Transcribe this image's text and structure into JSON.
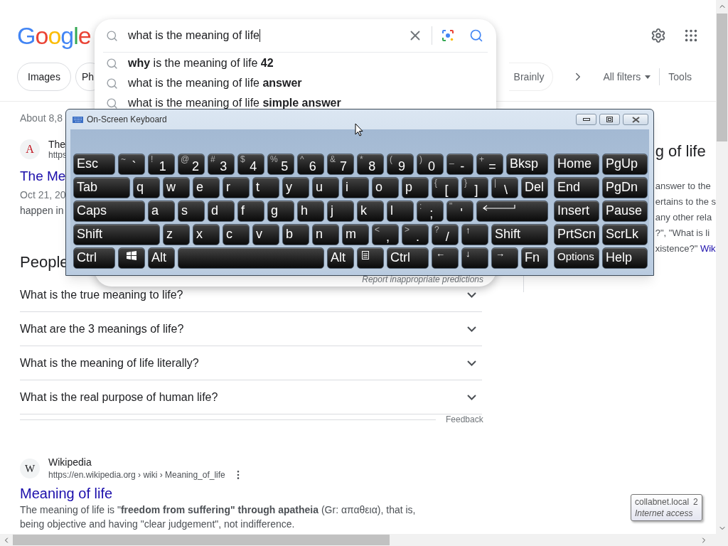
{
  "logo": "Google",
  "search": {
    "value": "what is the meaning of life",
    "suggestions": [
      "**why** is the meaning of life **42**",
      "what is the meaning of life **answer**",
      "what is the meaning of life **simple answer**"
    ],
    "report_link": "Report inappropriate predictions"
  },
  "chips": [
    {
      "label": "Images"
    },
    {
      "label": "Ph"
    }
  ],
  "right_chips": [
    {
      "label": "Brainly"
    }
  ],
  "all_filters": "All filters",
  "tools": "Tools",
  "result_stats": "About 8,8",
  "first_result": {
    "favicon": "A",
    "site": "The",
    "url": "https",
    "title": "The Me",
    "date": "Oct 21, 20",
    "snippet": "happen in"
  },
  "people_also_ask": {
    "heading": "People",
    "questions": [
      {
        "text": "What is the true meaning to life?",
        "expanded": false
      },
      {
        "text": "What are the 3 meanings of life?",
        "expanded": false
      },
      {
        "text": "What is the meaning of life literally?",
        "expanded": false
      },
      {
        "text": "What is the real purpose of human life?",
        "expanded": false
      }
    ]
  },
  "feedback": "Feedback",
  "wiki_result": {
    "favicon": "W",
    "site": "Wikipedia",
    "url": "https://en.wikipedia.org › wiki › Meaning_of_life",
    "title": "Meaning of life",
    "snippet": [
      "The meaning of life is \"**freedom from suffering\" through apatheia** (Gr: απαθεια), that is,",
      "being objective and having \"clear judgement\", not indifference."
    ]
  },
  "knowledge_panel": {
    "title": "g of life",
    "lines": [
      {
        "text": "answer to the"
      },
      {
        "text": "ertains to the s"
      },
      {
        "text": "any other rela"
      },
      {
        "text": "?\", \"What is li"
      },
      {
        "text": "xistence?\"",
        "link": "Wik"
      }
    ]
  },
  "keyboard": {
    "title": "On-Screen Keyboard",
    "rows": [
      {
        "keys": [
          {
            "kind": "text",
            "label": "Esc"
          },
          {
            "kind": "dual",
            "label": "`",
            "shift": "~"
          },
          {
            "kind": "dual",
            "label": "1",
            "shift": "!"
          },
          {
            "kind": "dual",
            "label": "2",
            "shift": "@"
          },
          {
            "kind": "dual",
            "label": "3",
            "shift": "#"
          },
          {
            "kind": "dual",
            "label": "4",
            "shift": "$"
          },
          {
            "kind": "dual",
            "label": "5",
            "shift": "%"
          },
          {
            "kind": "dual",
            "label": "6",
            "shift": "^"
          },
          {
            "kind": "dual",
            "label": "7",
            "shift": "&"
          },
          {
            "kind": "dual",
            "label": "8",
            "shift": "*"
          },
          {
            "kind": "dual",
            "label": "9",
            "shift": "("
          },
          {
            "kind": "dual",
            "label": "0",
            "shift": ")"
          },
          {
            "kind": "dual",
            "label": "-",
            "shift": "_"
          },
          {
            "kind": "dual",
            "label": "=",
            "shift": "+"
          },
          {
            "kind": "text",
            "label": "Bksp"
          }
        ]
      },
      {
        "keys": [
          {
            "kind": "text",
            "label": "Tab"
          },
          {
            "kind": "text",
            "label": "q"
          },
          {
            "kind": "text",
            "label": "w"
          },
          {
            "kind": "text",
            "label": "e"
          },
          {
            "kind": "text",
            "label": "r"
          },
          {
            "kind": "text",
            "label": "t"
          },
          {
            "kind": "text",
            "label": "y"
          },
          {
            "kind": "text",
            "label": "u"
          },
          {
            "kind": "text",
            "label": "i"
          },
          {
            "kind": "text",
            "label": "o"
          },
          {
            "kind": "text",
            "label": "p"
          },
          {
            "kind": "dual",
            "label": "[",
            "shift": "{"
          },
          {
            "kind": "dual",
            "label": "]",
            "shift": "}"
          },
          {
            "kind": "dual",
            "label": "\\",
            "shift": "|"
          },
          {
            "kind": "text",
            "label": "Del"
          }
        ]
      },
      {
        "keys": [
          {
            "kind": "text",
            "label": "Caps"
          },
          {
            "kind": "text",
            "label": "a"
          },
          {
            "kind": "text",
            "label": "s"
          },
          {
            "kind": "text",
            "label": "d"
          },
          {
            "kind": "text",
            "label": "f"
          },
          {
            "kind": "text",
            "label": "g"
          },
          {
            "kind": "text",
            "label": "h"
          },
          {
            "kind": "text",
            "label": "j"
          },
          {
            "kind": "text",
            "label": "k"
          },
          {
            "kind": "text",
            "label": "l"
          },
          {
            "kind": "dual",
            "label": ";",
            "shift": ":"
          },
          {
            "kind": "dual",
            "label": "'",
            "shift": "\""
          },
          {
            "kind": "enter"
          }
        ]
      },
      {
        "keys": [
          {
            "kind": "text",
            "label": "Shift"
          },
          {
            "kind": "text",
            "label": "z"
          },
          {
            "kind": "text",
            "label": "x"
          },
          {
            "kind": "text",
            "label": "c"
          },
          {
            "kind": "text",
            "label": "v"
          },
          {
            "kind": "text",
            "label": "b"
          },
          {
            "kind": "text",
            "label": "n"
          },
          {
            "kind": "text",
            "label": "m"
          },
          {
            "kind": "dual",
            "label": ",",
            "shift": "<"
          },
          {
            "kind": "dual",
            "label": ".",
            "shift": ">"
          },
          {
            "kind": "dual",
            "label": "/",
            "shift": "?"
          },
          {
            "kind": "arrow",
            "label": "↑"
          },
          {
            "kind": "text",
            "label": "Shift"
          }
        ]
      },
      {
        "keys": [
          {
            "kind": "text",
            "label": "Ctrl"
          },
          {
            "kind": "windows"
          },
          {
            "kind": "text",
            "label": "Alt"
          },
          {
            "kind": "space"
          },
          {
            "kind": "text",
            "label": "Alt"
          },
          {
            "kind": "menu"
          },
          {
            "kind": "text",
            "label": "Ctrl"
          },
          {
            "kind": "arrow",
            "label": "←"
          },
          {
            "kind": "arrow",
            "label": "↓"
          },
          {
            "kind": "arrow",
            "label": "→"
          },
          {
            "kind": "text",
            "label": "Fn"
          }
        ]
      }
    ],
    "nav_rows": [
      {
        "keys": [
          "Home",
          "PgUp"
        ]
      },
      {
        "keys": [
          "End",
          "PgDn"
        ]
      },
      {
        "keys": [
          "Insert",
          "Pause"
        ]
      },
      {
        "keys": [
          "PrtScn",
          "ScrLk"
        ]
      },
      {
        "keys": [
          "Options",
          "Help"
        ]
      }
    ]
  },
  "tooltip": {
    "title": "collabnet.local",
    "count": "2",
    "subtitle": "Internet access"
  }
}
